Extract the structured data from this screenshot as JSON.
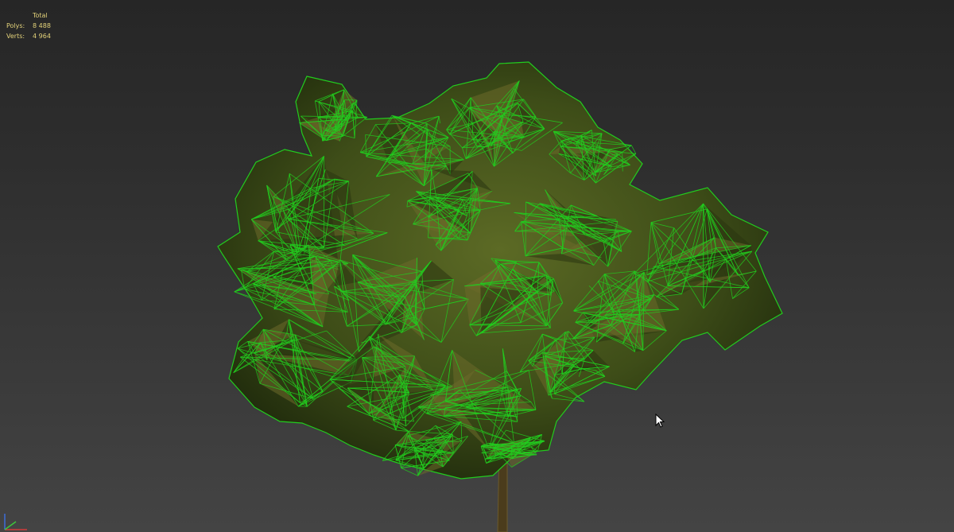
{
  "viewport": {
    "background_top": "#262626",
    "background_bottom": "#444444"
  },
  "stats": {
    "header": "Total",
    "rows": [
      {
        "label": "Polys:",
        "value": "8 488"
      },
      {
        "label": "Verts:",
        "value": "4 964"
      }
    ],
    "text_color": "#e3d27a"
  },
  "scene": {
    "object": "tree-mesh",
    "display_mode": "wireframe-over-shaded",
    "wire_color": "#22cc1e",
    "leaf_shade_color": "#4a5a1c",
    "trunk_color": "#5b4a24"
  },
  "icons": {
    "cursor": "arrow-cursor-icon",
    "axis": "axis-gizmo-icon"
  }
}
